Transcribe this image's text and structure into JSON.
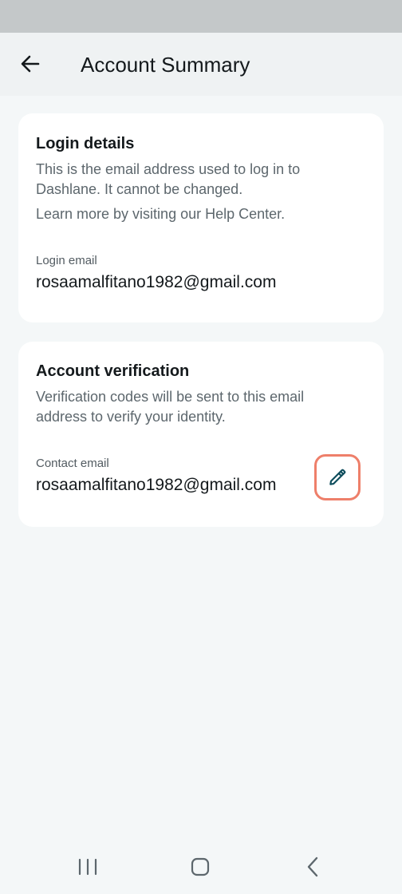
{
  "header": {
    "title": "Account Summary",
    "back_icon": "arrow-left-icon"
  },
  "login_details": {
    "title": "Login details",
    "description": "This is the email address used to log in to Dashlane. It cannot be changed.",
    "help_text": "Learn more by visiting our Help Center.",
    "field_label": "Login email",
    "field_value": "rosaamalfitano1982@gmail.com"
  },
  "account_verification": {
    "title": "Account verification",
    "description": "Verification codes will be sent to this email address to verify your identity.",
    "field_label": "Contact email",
    "field_value": "rosaamalfitano1982@gmail.com",
    "edit_icon": "pencil-icon",
    "edit_highlight_color": "#ee7f6a"
  },
  "system_nav": {
    "recents_icon": "recents-icon",
    "home_icon": "home-icon",
    "back_icon": "chevron-left-icon"
  },
  "colors": {
    "background": "#f4f7f8",
    "card": "#ffffff",
    "text_primary": "#14191c",
    "text_secondary": "#5d676d",
    "icon_accent": "#0e4d5c"
  }
}
